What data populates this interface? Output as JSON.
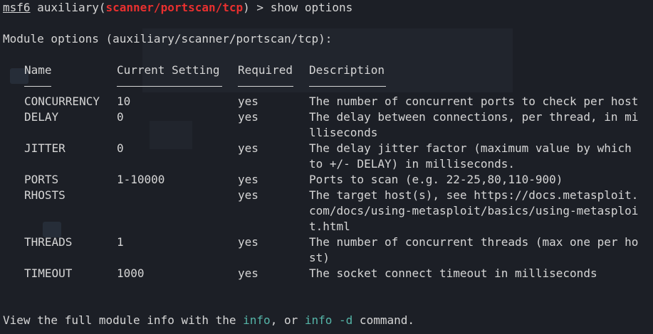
{
  "prompt": {
    "app": "msf6",
    "context_prefix": " auxiliary(",
    "module": "scanner/portscan/tcp",
    "context_suffix": ") > ",
    "command": "show options"
  },
  "heading": "Module options (auxiliary/scanner/portscan/tcp):",
  "columns": {
    "name": "Name",
    "setting": "Current Setting",
    "required": "Required",
    "description": "Description"
  },
  "rows": [
    {
      "name": "CONCURRENCY",
      "setting": "10",
      "required": "yes",
      "desc": [
        "The number of concurrent ports to check per host"
      ]
    },
    {
      "name": "DELAY",
      "setting": "0",
      "required": "yes",
      "desc": [
        "The delay between connections, per thread, in mi",
        "lliseconds"
      ]
    },
    {
      "name": "JITTER",
      "setting": "0",
      "required": "yes",
      "desc": [
        "The delay jitter factor (maximum value by which",
        "to +/- DELAY) in milliseconds."
      ]
    },
    {
      "name": "PORTS",
      "setting": "1-10000",
      "required": "yes",
      "desc": [
        "Ports to scan (e.g. 22-25,80,110-900)"
      ]
    },
    {
      "name": "RHOSTS",
      "setting": "",
      "required": "yes",
      "desc": [
        "The target host(s), see https://docs.metasploit.",
        "com/docs/using-metasploit/basics/using-metasploi",
        "t.html"
      ]
    },
    {
      "name": "THREADS",
      "setting": "1",
      "required": "yes",
      "desc": [
        "The number of concurrent threads (max one per ho",
        "st)"
      ]
    },
    {
      "name": "TIMEOUT",
      "setting": "1000",
      "required": "yes",
      "desc": [
        "The socket connect timeout in milliseconds"
      ]
    }
  ],
  "footer": {
    "prefix": "View the full module info with the ",
    "cmd1": "info",
    "middle": ", or ",
    "cmd2": "info -d",
    "suffix": " command."
  },
  "colors": {
    "background": "#1c1f26",
    "text": "#d6d6d6",
    "module": "#e8302f",
    "command_link": "#55b5a8"
  }
}
